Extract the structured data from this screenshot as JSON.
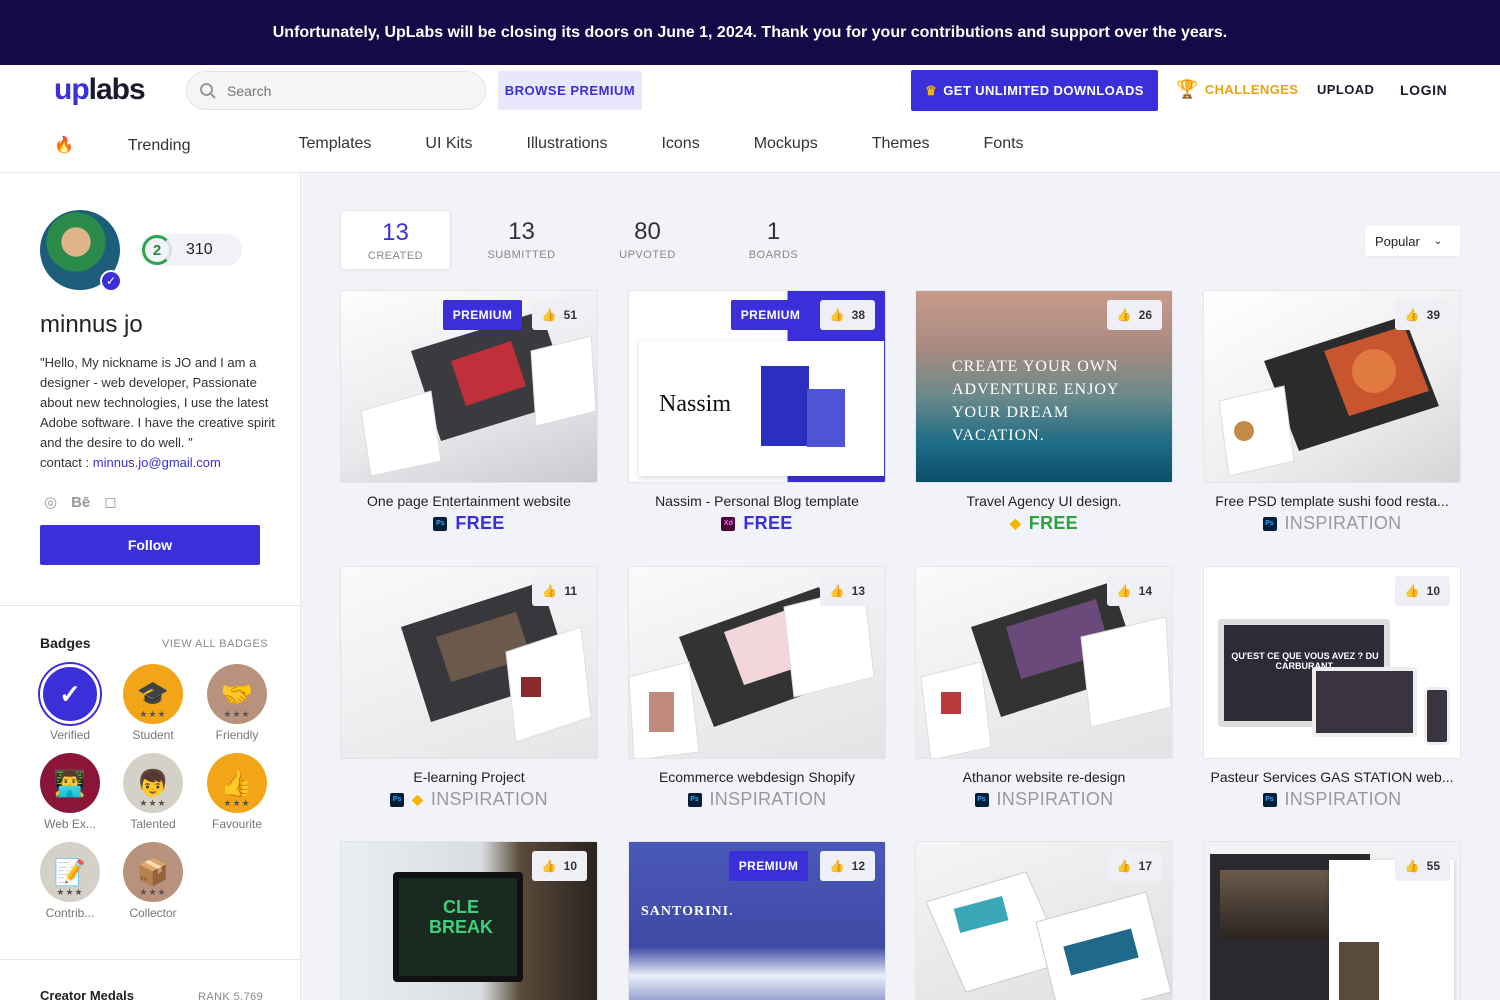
{
  "banner": "Unfortunately, UpLabs will be closing its doors on June 1, 2024. Thank you for your contributions and support over the years.",
  "header": {
    "logo_up": "up",
    "logo_labs": "labs",
    "search_placeholder": "Search",
    "browse_premium": "BROWSE PREMIUM",
    "get_unlimited": "GET UNLIMITED DOWNLOADS",
    "challenges": "CHALLENGES",
    "upload": "UPLOAD",
    "login": "LOGIN"
  },
  "categories": [
    "Trending",
    "Templates",
    "UI Kits",
    "Illustrations",
    "Icons",
    "Mockups",
    "Themes",
    "Fonts"
  ],
  "profile": {
    "level": "2",
    "points": "310",
    "name": "minnus jo",
    "bio": "\"Hello, My nickname is JO and I am a designer - web developer, Passionate about new technologies, I use the latest Adobe software. I have the creative spirit and the desire to do well. \"",
    "contact_label": "contact :",
    "email": "minnus.jo@gmail.com",
    "follow": "Follow"
  },
  "badges": {
    "title": "Badges",
    "view_all": "VIEW ALL BADGES",
    "items": [
      {
        "label": "Verified",
        "color": "#3b2fd9"
      },
      {
        "label": "Student",
        "color": "#f2a516"
      },
      {
        "label": "Friendly",
        "color": "#b9927d"
      },
      {
        "label": "Web Ex...",
        "color": "#8a1538"
      },
      {
        "label": "Talented",
        "color": "#d4d2c8"
      },
      {
        "label": "Favourite",
        "color": "#f2a516"
      },
      {
        "label": "Contrib...",
        "color": "#d4d2c8"
      },
      {
        "label": "Collector",
        "color": "#b9927d"
      }
    ]
  },
  "medals": {
    "title": "Creator Medals",
    "rank": "RANK 5,769"
  },
  "stats": [
    {
      "n": "13",
      "l": "CREATED"
    },
    {
      "n": "13",
      "l": "SUBMITTED"
    },
    {
      "n": "80",
      "l": "UPVOTED"
    },
    {
      "n": "1",
      "l": "BOARDS"
    }
  ],
  "sort": "Popular",
  "premium_label": "PREMIUM",
  "cards": [
    {
      "title": "One page Entertainment website",
      "likes": "51",
      "premium": true,
      "apps": [
        "Ps"
      ],
      "price": "FREE"
    },
    {
      "title": "Nassim - Personal Blog template",
      "likes": "38",
      "premium": true,
      "apps": [
        "Xd"
      ],
      "price": "FREE",
      "thumb_text": "Nassim"
    },
    {
      "title": "Travel Agency UI design.",
      "likes": "26",
      "premium": false,
      "apps": [
        "Sketch"
      ],
      "price": "FREE",
      "thumb_text": "CREATE YOUR OWN ADVENTURE ENJOY YOUR DREAM VACATION."
    },
    {
      "title": "Free PSD template sushi food resta...",
      "likes": "39",
      "premium": false,
      "apps": [
        "Ps"
      ],
      "price": "INSPIRATION"
    },
    {
      "title": "E-learning Project",
      "likes": "11",
      "premium": false,
      "apps": [
        "Ps",
        "Sketch"
      ],
      "price": "INSPIRATION"
    },
    {
      "title": "Ecommerce webdesign Shopify",
      "likes": "13",
      "premium": false,
      "apps": [
        "Ps"
      ],
      "price": "INSPIRATION"
    },
    {
      "title": "Athanor website re-design",
      "likes": "14",
      "premium": false,
      "apps": [
        "Ps"
      ],
      "price": "INSPIRATION"
    },
    {
      "title": "Pasteur Services GAS STATION web...",
      "likes": "10",
      "premium": false,
      "apps": [
        "Ps"
      ],
      "price": "INSPIRATION",
      "thumb_text": "QU'EST CE QUE VOUS AVEZ ? DU CARBURANT."
    },
    {
      "title": "",
      "likes": "10",
      "premium": false,
      "apps": [],
      "price": "",
      "thumb_text": "CLE BREAK"
    },
    {
      "title": "",
      "likes": "12",
      "premium": true,
      "apps": [],
      "price": "",
      "thumb_text": "SANTORINI."
    },
    {
      "title": "",
      "likes": "17",
      "premium": false,
      "apps": [],
      "price": ""
    },
    {
      "title": "",
      "likes": "55",
      "premium": false,
      "apps": [],
      "price": ""
    }
  ],
  "colors": {
    "accent": "#3b2fd9",
    "banner": "#150a47",
    "challenges": "#e8a314",
    "free_green": "#2ea043"
  }
}
